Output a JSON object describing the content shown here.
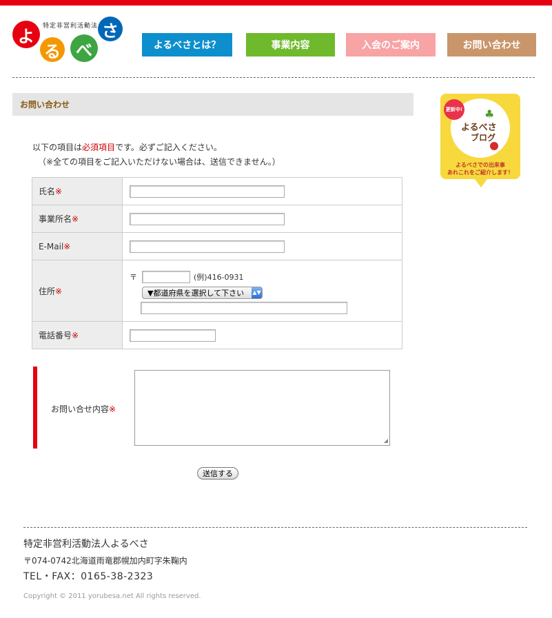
{
  "brand": {
    "org_small": "特定非営利活動法人",
    "logo_chars": [
      "よ",
      "る",
      "べ",
      "さ"
    ],
    "logo_colors": [
      "#e60012",
      "#f39800",
      "#3ea542",
      "#0068b7"
    ]
  },
  "nav": [
    {
      "label": "よるべさとは？"
    },
    {
      "label": "事業内容"
    },
    {
      "label": "入会のご案内"
    },
    {
      "label": "お問い合わせ"
    }
  ],
  "page": {
    "section_title": "お問い合わせ",
    "intro_prefix": "以下の項目は",
    "intro_required": "必須項目",
    "intro_suffix": "です。必ずご記入ください。",
    "intro_note": "（※全ての項目をご記入いただけない場合は、送信できません。）"
  },
  "form": {
    "required_mark": "※",
    "fields": {
      "name": {
        "label": "氏名",
        "value": ""
      },
      "office": {
        "label": "事業所名",
        "value": ""
      },
      "email": {
        "label": "E-Mail",
        "value": ""
      },
      "address": {
        "label": "住所",
        "postal_symbol": "〒",
        "postal_value": "",
        "postal_example": "(例)416-0931",
        "prefecture_selected": "▼都道府県を選択して下さい",
        "street_value": ""
      },
      "phone": {
        "label": "電話番号",
        "value": ""
      }
    },
    "inquiry_label": "お問い合せ内容",
    "submit_label": "送信する"
  },
  "blog_badge": {
    "new_label": "更新中!",
    "title_line1": "よるべさ",
    "title_line2": "ブログ",
    "caption_line1": "よるべさでの出来事",
    "caption_line2": "あれこれをご紹介します！"
  },
  "footer": {
    "org": "特定非営利活動法人よるべさ",
    "address": "〒074-0742北海道雨竜郡幌加内町字朱鞠内",
    "tel": "TEL・FAX：0165-38-2323",
    "copyright": "Copyright © 2011 yorubesa.net All rights reserved."
  },
  "colors": {
    "accent_red": "#e60012",
    "nav_blue": "#0d8fcd",
    "nav_green": "#6fb92c",
    "nav_pink": "#f8a3a4",
    "nav_brown": "#c9956a"
  }
}
